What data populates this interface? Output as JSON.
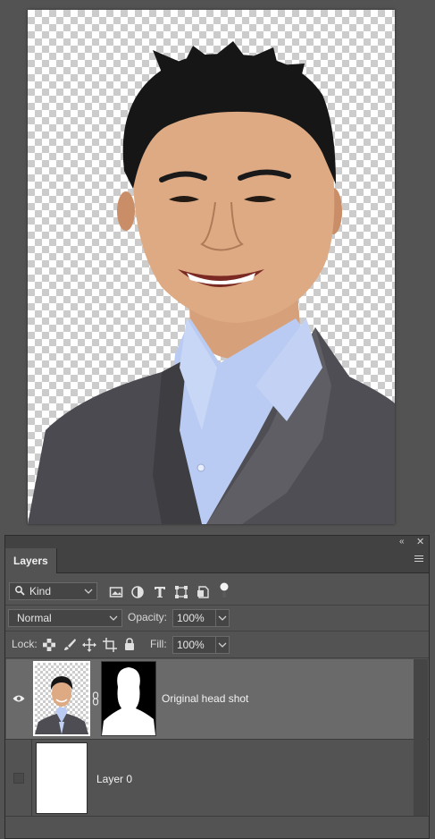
{
  "canvas": {
    "image": "headshot-man-in-grey-suit-on-transparent",
    "background": "transparency-checkerboard"
  },
  "panel": {
    "controls": {
      "collapse_icon": "double-chevron-left-icon",
      "close_icon": "close-icon"
    },
    "tab_label": "Layers",
    "menu_icon": "hamburger-menu-icon",
    "filter": {
      "search_icon": "magnifier-icon",
      "kind_label": "Kind",
      "filter_icons": [
        "image-filter-icon",
        "adjustment-filter-icon",
        "type-filter-icon",
        "shape-filter-icon",
        "smart-object-filter-icon",
        "filter-toggle-icon"
      ]
    },
    "blend": {
      "mode": "Normal",
      "opacity_label": "Opacity:",
      "opacity_value": "100%"
    },
    "lock": {
      "label": "Lock:",
      "icons": [
        "lock-transparent-pixels-icon",
        "lock-image-pixels-icon",
        "lock-position-icon",
        "lock-artboard-icon",
        "lock-all-icon"
      ],
      "fill_label": "Fill:",
      "fill_value": "100%"
    },
    "layers": [
      {
        "name": "Original head shot",
        "visible": true,
        "selected": true,
        "has_mask": true
      },
      {
        "name": "Layer 0",
        "visible": false,
        "selected": false,
        "has_mask": false
      }
    ]
  },
  "colors": {
    "workspace": "#535353",
    "panel_dark": "#424242",
    "selected_row": "#6a6a6a",
    "text": "#f2f2f2"
  }
}
